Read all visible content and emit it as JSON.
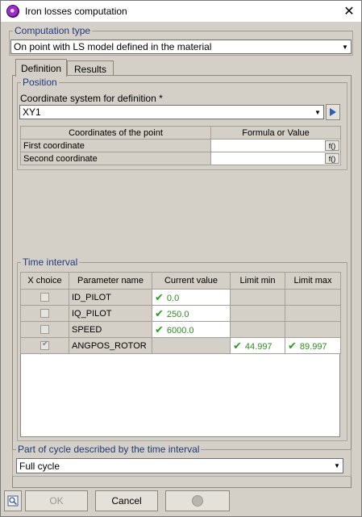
{
  "window": {
    "title": "Iron losses computation",
    "close": "✕"
  },
  "computation_type": {
    "legend": "Computation type",
    "value": "On point with LS model defined in the material"
  },
  "tabs": [
    {
      "label": "Definition",
      "active": true
    },
    {
      "label": "Results",
      "active": false
    }
  ],
  "position": {
    "legend": "Position",
    "coord_system_label": "Coordinate system for definition *",
    "coord_system_value": "XY1",
    "headers": [
      "Coordinates of the point",
      "Formula or Value"
    ],
    "rows": [
      {
        "name": "First coordinate",
        "value": "",
        "fx": "f()"
      },
      {
        "name": "Second coordinate",
        "value": "",
        "fx": "f()"
      }
    ]
  },
  "time_interval": {
    "legend": "Time interval",
    "headers": [
      "X choice",
      "Parameter name",
      "Current value",
      "Limit min",
      "Limit max"
    ],
    "rows": [
      {
        "checked": false,
        "name": "ID_PILOT",
        "current": "0.0",
        "min": "",
        "max": ""
      },
      {
        "checked": false,
        "name": "IQ_PILOT",
        "current": "250.0",
        "min": "",
        "max": ""
      },
      {
        "checked": false,
        "name": "SPEED",
        "current": "6000.0",
        "min": "",
        "max": ""
      },
      {
        "checked": true,
        "name": "ANGPOS_ROTOR",
        "current": "",
        "min": "44.997",
        "max": "89.997"
      }
    ]
  },
  "cycle": {
    "legend": "Part of cycle described by the time interval",
    "value": "Full cycle"
  },
  "buttons": {
    "ok": "OK",
    "cancel": "Cancel"
  },
  "colors": {
    "legend": "#1f3a7a",
    "check_green": "#2f9a23",
    "background": "#d4d0c8"
  }
}
